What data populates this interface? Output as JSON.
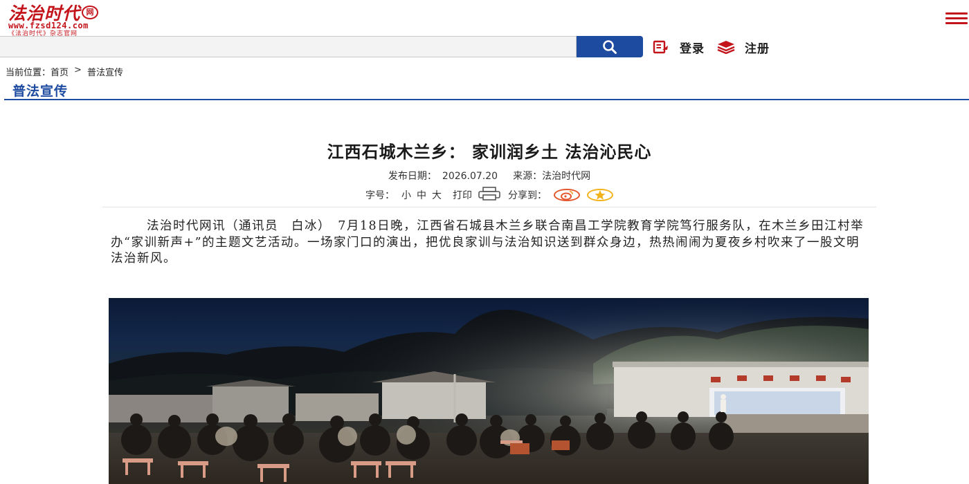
{
  "header": {
    "logo_title": "法治时代",
    "logo_badge": "网",
    "logo_url": "www.fzsd124.com",
    "logo_sub": "《法治时代》杂志官网",
    "menu_icon": "hamburger-menu-icon",
    "brand_color": "#c3141b"
  },
  "search": {
    "value": "",
    "placeholder": "",
    "button_icon": "search-icon",
    "button_color": "#1d4ba0"
  },
  "auth": {
    "login_label": "登录",
    "register_label": "注册",
    "login_icon": "login-icon",
    "register_icon": "register-icon"
  },
  "breadcrumb": {
    "prefix": "当前位置：",
    "home": "首页",
    "separator": ">",
    "current": "普法宣传"
  },
  "section": {
    "title": "普法宣传",
    "accent": "#1d4ba0"
  },
  "article": {
    "title": "江西石城木兰乡： 家训润乡土 法治沁民心",
    "date_label": "发布日期：",
    "date": "2026.07.20",
    "source_label": "来源：",
    "source": "法治时代网",
    "font_size_label": "字号：",
    "font_sizes": [
      "小",
      "中",
      "大"
    ],
    "print_label": "打印",
    "print_icon": "printer-icon",
    "share_label": "分享到：",
    "share_icons": [
      "weibo-icon",
      "qzone-icon"
    ],
    "paragraph": "法治时代网讯（通讯员　白冰）　7月18日晚，江西省石城县木兰乡联合南昌工学院教育学院笃行服务队，在木兰乡田江村举办“家训新声+”的主题文艺活动。一场家门口的演出，把优良家训与法治知识送到群众身边，热热闹闹为夏夜乡村吹来了一股文明法治新风。"
  }
}
